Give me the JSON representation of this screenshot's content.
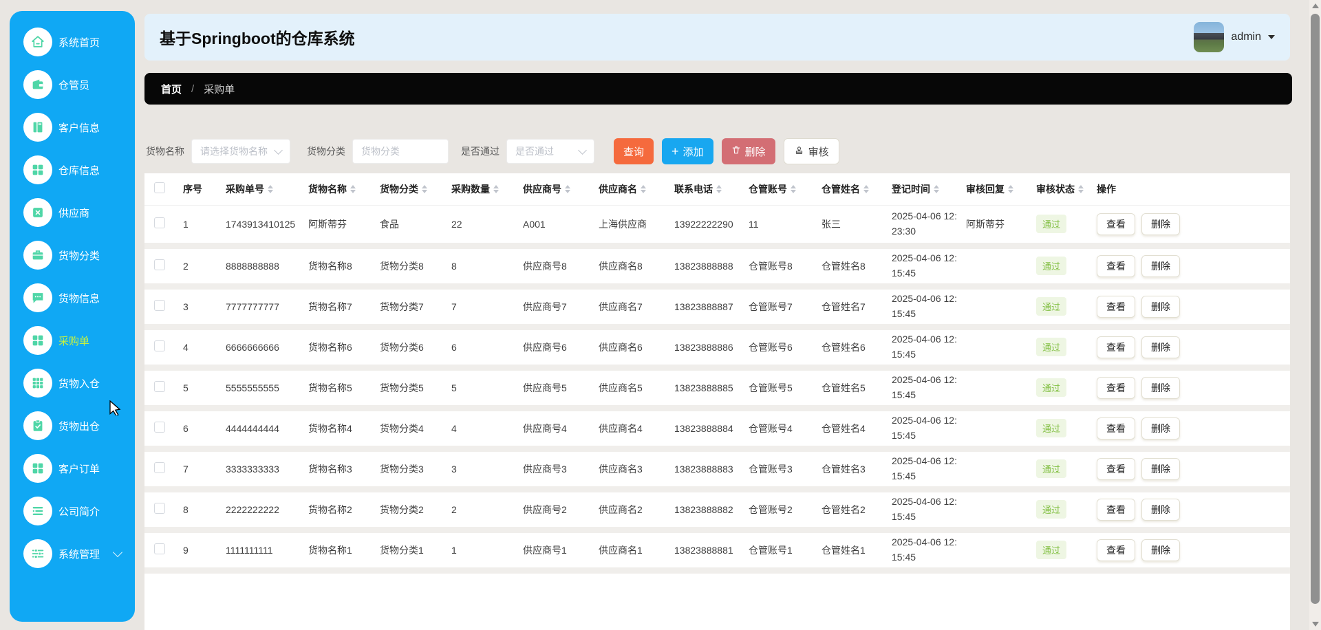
{
  "header": {
    "title": "基于Springboot的仓库系统",
    "user_name": "admin"
  },
  "breadcrumb": {
    "home": "首页",
    "separator": "/",
    "current": "采购单"
  },
  "sidebar": {
    "items": [
      {
        "key": "home",
        "label": "系统首页",
        "icon": "home-icon"
      },
      {
        "key": "keeper",
        "label": "仓管员",
        "icon": "wallet-icon"
      },
      {
        "key": "customer-info",
        "label": "客户信息",
        "icon": "notebook-icon"
      },
      {
        "key": "warehouse-info",
        "label": "仓库信息",
        "icon": "grid-icon"
      },
      {
        "key": "supplier",
        "label": "供应商",
        "icon": "box-icon"
      },
      {
        "key": "goods-category",
        "label": "货物分类",
        "icon": "briefcase-icon"
      },
      {
        "key": "goods-info",
        "label": "货物信息",
        "icon": "chat-icon"
      },
      {
        "key": "purchase-order",
        "label": "采购单",
        "icon": "grid-icon",
        "selected": true
      },
      {
        "key": "goods-inbound",
        "label": "货物入仓",
        "icon": "grid9-icon"
      },
      {
        "key": "goods-outbound",
        "label": "货物出仓",
        "icon": "clipboard-check-icon"
      },
      {
        "key": "customer-order",
        "label": "客户订单",
        "icon": "grid-icon"
      },
      {
        "key": "company-profile",
        "label": "公司简介",
        "icon": "list-icon"
      },
      {
        "key": "system-manage",
        "label": "系统管理",
        "icon": "sliders-icon",
        "expandable": true
      }
    ]
  },
  "toolbar": {
    "goods_name_label": "货物名称",
    "goods_name_placeholder": "请选择货物名称",
    "goods_category_label": "货物分类",
    "goods_category_placeholder": "货物分类",
    "pass_label": "是否通过",
    "pass_placeholder": "是否通过",
    "query_button": "查询",
    "add_button": "添加",
    "delete_button": "删除",
    "audit_button": "审核"
  },
  "table": {
    "columns": [
      {
        "label": "序号",
        "sortable": false
      },
      {
        "label": "采购单号",
        "sortable": true
      },
      {
        "label": "货物名称",
        "sortable": true
      },
      {
        "label": "货物分类",
        "sortable": true
      },
      {
        "label": "采购数量",
        "sortable": true
      },
      {
        "label": "供应商号",
        "sortable": true
      },
      {
        "label": "供应商名",
        "sortable": true
      },
      {
        "label": "联系电话",
        "sortable": true
      },
      {
        "label": "仓管账号",
        "sortable": true
      },
      {
        "label": "仓管姓名",
        "sortable": true
      },
      {
        "label": "登记时间",
        "sortable": true
      },
      {
        "label": "审核回复",
        "sortable": true
      },
      {
        "label": "审核状态",
        "sortable": true
      },
      {
        "label": "操作",
        "sortable": false
      }
    ],
    "field_order": [
      "seq",
      "order_no",
      "goods_name",
      "goods_category",
      "quantity",
      "supplier_no",
      "supplier_name",
      "phone",
      "keeper_account",
      "keeper_name",
      "register_time",
      "audit_reply"
    ],
    "actions": [
      {
        "label": "查看"
      },
      {
        "label": "删除"
      }
    ],
    "rows": [
      {
        "seq": "1",
        "order_no": "1743913410125",
        "goods_name": "阿斯蒂芬",
        "goods_category": "食品",
        "quantity": "22",
        "supplier_no": "A001",
        "supplier_name": "上海供应商",
        "phone": "13922222290",
        "keeper_account": "11",
        "keeper_name": "张三",
        "register_time": "2025-04-06 12:23:30",
        "audit_reply": "阿斯蒂芬",
        "audit_status": "通过"
      },
      {
        "seq": "2",
        "order_no": "8888888888",
        "goods_name": "货物名称8",
        "goods_category": "货物分类8",
        "quantity": "8",
        "supplier_no": "供应商号8",
        "supplier_name": "供应商名8",
        "phone": "13823888888",
        "keeper_account": "仓管账号8",
        "keeper_name": "仓管姓名8",
        "register_time": "2025-04-06 12:15:45",
        "audit_reply": "",
        "audit_status": "通过"
      },
      {
        "seq": "3",
        "order_no": "7777777777",
        "goods_name": "货物名称7",
        "goods_category": "货物分类7",
        "quantity": "7",
        "supplier_no": "供应商号7",
        "supplier_name": "供应商名7",
        "phone": "13823888887",
        "keeper_account": "仓管账号7",
        "keeper_name": "仓管姓名7",
        "register_time": "2025-04-06 12:15:45",
        "audit_reply": "",
        "audit_status": "通过"
      },
      {
        "seq": "4",
        "order_no": "6666666666",
        "goods_name": "货物名称6",
        "goods_category": "货物分类6",
        "quantity": "6",
        "supplier_no": "供应商号6",
        "supplier_name": "供应商名6",
        "phone": "13823888886",
        "keeper_account": "仓管账号6",
        "keeper_name": "仓管姓名6",
        "register_time": "2025-04-06 12:15:45",
        "audit_reply": "",
        "audit_status": "通过"
      },
      {
        "seq": "5",
        "order_no": "5555555555",
        "goods_name": "货物名称5",
        "goods_category": "货物分类5",
        "quantity": "5",
        "supplier_no": "供应商号5",
        "supplier_name": "供应商名5",
        "phone": "13823888885",
        "keeper_account": "仓管账号5",
        "keeper_name": "仓管姓名5",
        "register_time": "2025-04-06 12:15:45",
        "audit_reply": "",
        "audit_status": "通过"
      },
      {
        "seq": "6",
        "order_no": "4444444444",
        "goods_name": "货物名称4",
        "goods_category": "货物分类4",
        "quantity": "4",
        "supplier_no": "供应商号4",
        "supplier_name": "供应商名4",
        "phone": "13823888884",
        "keeper_account": "仓管账号4",
        "keeper_name": "仓管姓名4",
        "register_time": "2025-04-06 12:15:45",
        "audit_reply": "",
        "audit_status": "通过"
      },
      {
        "seq": "7",
        "order_no": "3333333333",
        "goods_name": "货物名称3",
        "goods_category": "货物分类3",
        "quantity": "3",
        "supplier_no": "供应商号3",
        "supplier_name": "供应商名3",
        "phone": "13823888883",
        "keeper_account": "仓管账号3",
        "keeper_name": "仓管姓名3",
        "register_time": "2025-04-06 12:15:45",
        "audit_reply": "",
        "audit_status": "通过"
      },
      {
        "seq": "8",
        "order_no": "2222222222",
        "goods_name": "货物名称2",
        "goods_category": "货物分类2",
        "quantity": "2",
        "supplier_no": "供应商号2",
        "supplier_name": "供应商名2",
        "phone": "13823888882",
        "keeper_account": "仓管账号2",
        "keeper_name": "仓管姓名2",
        "register_time": "2025-04-06 12:15:45",
        "audit_reply": "",
        "audit_status": "通过"
      },
      {
        "seq": "9",
        "order_no": "1111111111",
        "goods_name": "货物名称1",
        "goods_category": "货物分类1",
        "quantity": "1",
        "supplier_no": "供应商号1",
        "supplier_name": "供应商名1",
        "phone": "13823888881",
        "keeper_account": "仓管账号1",
        "keeper_name": "仓管姓名1",
        "register_time": "2025-04-06 12:15:45",
        "audit_reply": "",
        "audit_status": "通过"
      }
    ]
  },
  "colors": {
    "sidebar_bg": "#10a8f4",
    "sidebar_icon": "#4fd6a7",
    "sidebar_selected_text": "#c6f23f",
    "header_bg": "#e3f1fb",
    "breadcrumb_bg": "#070707",
    "query_button": "#f56a3d",
    "add_button": "#18a7f0",
    "delete_button": "#d36e74",
    "status_badge_text": "#83c044",
    "status_badge_bg": "#eef6e3"
  }
}
